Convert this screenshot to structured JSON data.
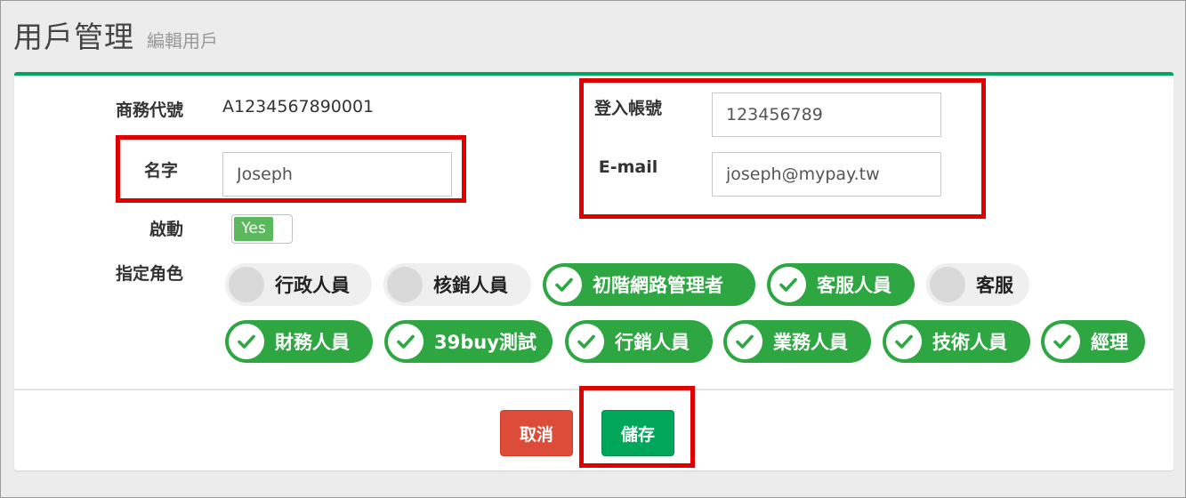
{
  "header": {
    "title": "用戶管理",
    "subtitle": "編輯用戶"
  },
  "form": {
    "merchant_id_label": "商務代號",
    "merchant_id_value": "A1234567890001",
    "name_label": "名字",
    "name_value": "Joseph",
    "login_label": "登入帳號",
    "login_value": "123456789",
    "email_label": "E-mail",
    "email_value": "joseph@mypay.tw",
    "active_label": "啟動",
    "active_value": "Yes",
    "roles_label": "指定角色"
  },
  "roles": [
    {
      "label": "行政人員",
      "checked": false
    },
    {
      "label": "核銷人員",
      "checked": false
    },
    {
      "label": "初階網路管理者",
      "checked": true
    },
    {
      "label": "客服人員",
      "checked": true
    },
    {
      "label": "客服",
      "checked": false
    },
    {
      "label": "財務人員",
      "checked": true
    },
    {
      "label": "39buy測試",
      "checked": true
    },
    {
      "label": "行銷人員",
      "checked": true
    },
    {
      "label": "業務人員",
      "checked": true
    },
    {
      "label": "技術人員",
      "checked": true
    },
    {
      "label": "經理",
      "checked": true
    }
  ],
  "actions": {
    "cancel_label": "取消",
    "save_label": "儲存"
  },
  "colors": {
    "accent": "#00a65a",
    "chip_on": "#2ea743",
    "cancel": "#dd4b39",
    "highlight": "#e00000"
  }
}
